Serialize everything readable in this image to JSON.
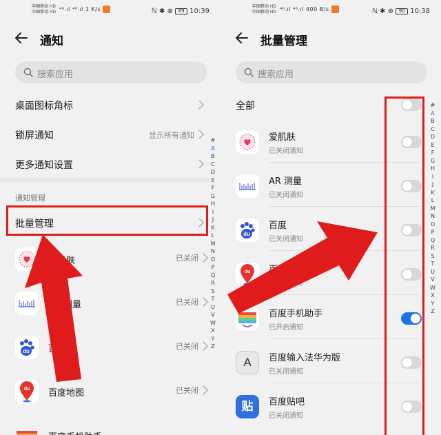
{
  "left_screen": {
    "status": {
      "carrier_1": "中国移动 HD",
      "carrier_2": "中国移动 HD",
      "signal": "⁴⁶.ıl ⁴⁶.ıl 1 K/s",
      "right_icons": "ℕ ✱ ⊗",
      "battery": "89",
      "time": "10:39"
    },
    "title": "通知",
    "search_placeholder": "搜索应用",
    "rows": [
      {
        "label": "桌面图标角标",
        "value": ""
      },
      {
        "label": "锁屏通知",
        "value": "显示所有通知"
      },
      {
        "label": "更多通知设置",
        "value": ""
      }
    ],
    "section_label": "通知管理",
    "batch_label": "批量管理",
    "apps": [
      {
        "name": "爱肌肤",
        "status": "已关闭",
        "icon": "heart-icon"
      },
      {
        "name": "AR 测量",
        "status": "已关闭",
        "icon": "ruler-icon"
      },
      {
        "name": "百度",
        "status": "已关闭",
        "icon": "baidu-paw-icon"
      },
      {
        "name": "百度地图",
        "status": "已关闭",
        "icon": "map-pin-icon"
      },
      {
        "name": "百度手机助手",
        "status": "",
        "icon": "rainbow-icon"
      }
    ],
    "alphabet": [
      "#",
      "A",
      "B",
      "C",
      "D",
      "E",
      "F",
      "G",
      "H",
      "I",
      "J",
      "K",
      "L",
      "M",
      "N",
      "O",
      "P",
      "Q",
      "R",
      "S",
      "T",
      "U",
      "V",
      "W",
      "X",
      "Y",
      "Z"
    ]
  },
  "right_screen": {
    "status": {
      "carrier_1": "中国移动 HD",
      "carrier_2": "中国移动 HD",
      "signal": "⁴⁶.ıl ⁴⁶.ıl 400 B/s",
      "right_icons": "ℕ ✱ ⊗",
      "battery": "90",
      "time": "10:38"
    },
    "title": "批量管理",
    "search_placeholder": "搜索应用",
    "all_label": "全部",
    "all_on": false,
    "apps": [
      {
        "name": "爱肌肤",
        "sub": "已关闭通知",
        "on": false,
        "icon": "heart-icon"
      },
      {
        "name": "AR 测量",
        "sub": "已关闭通知",
        "on": false,
        "icon": "ruler-icon"
      },
      {
        "name": "百度",
        "sub": "已关闭通知",
        "on": false,
        "icon": "baidu-paw-icon"
      },
      {
        "name": "百度地图",
        "sub": "已关闭通知",
        "on": false,
        "icon": "map-pin-icon"
      },
      {
        "name": "百度手机助手",
        "sub": "已开启通知",
        "on": true,
        "icon": "rainbow-icon"
      },
      {
        "name": "百度输入法华为版",
        "sub": "已关闭通知",
        "on": false,
        "icon": "keyboard-a-icon"
      },
      {
        "name": "百度贴吧",
        "sub": "已关闭通知",
        "on": false,
        "icon": "tieba-icon"
      }
    ],
    "tieba_glyph": "贴",
    "keyboard_glyph": "A",
    "baidu_glyph": "du",
    "map_glyph": "du",
    "alphabet": [
      "#",
      "A",
      "B",
      "C",
      "D",
      "E",
      "F",
      "G",
      "H",
      "I",
      "J",
      "K",
      "L",
      "M",
      "N",
      "O",
      "P",
      "Q",
      "R",
      "S",
      "T",
      "U",
      "V",
      "W",
      "X",
      "Y",
      "Z"
    ]
  },
  "colors": {
    "accent": "#1a73e8",
    "annotation_red": "#e01b1b"
  }
}
